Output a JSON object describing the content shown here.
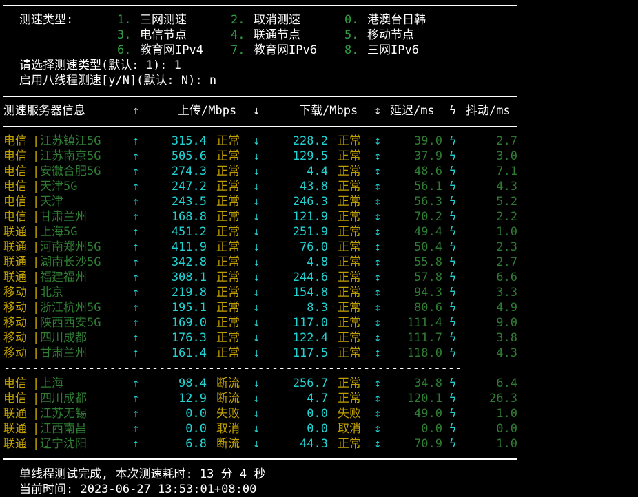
{
  "menu": {
    "label": "测速类型:",
    "options": [
      {
        "num": "1.",
        "text": "三网测速"
      },
      {
        "num": "2.",
        "text": "取消测速"
      },
      {
        "num": "0.",
        "text": "港澳台日韩"
      },
      {
        "num": "3.",
        "text": "电信节点"
      },
      {
        "num": "4.",
        "text": "联通节点"
      },
      {
        "num": "5.",
        "text": "移动节点"
      },
      {
        "num": "6.",
        "text": "教育网IPv4"
      },
      {
        "num": "7.",
        "text": "教育网IPv6"
      },
      {
        "num": "8.",
        "text": "三网IPv6"
      }
    ],
    "prompt_type": "请选择测速类型(默认: 1): 1",
    "prompt_threads": "启用八线程测速[y/N](默认: N): n"
  },
  "header": {
    "server": "测速服务器信息",
    "up_arrow": "↑",
    "upload": "上传/Mbps",
    "down_arrow": "↓",
    "download": "下载/Mbps",
    "updown_arrow": "↕",
    "latency": "延迟/ms",
    "jitter_symbol": "ϟ",
    "jitter": "抖动/ms"
  },
  "rows": [
    {
      "isp": "电信",
      "loc": "江苏镇江5G",
      "up": "315.4",
      "up_status": "正常",
      "down": "228.2",
      "down_status": "正常",
      "latency": "39.0",
      "jitter": "2.7"
    },
    {
      "isp": "电信",
      "loc": "江苏南京5G",
      "up": "505.6",
      "up_status": "正常",
      "down": "129.5",
      "down_status": "正常",
      "latency": "37.9",
      "jitter": "3.0"
    },
    {
      "isp": "电信",
      "loc": "安徽合肥5G",
      "up": "274.3",
      "up_status": "正常",
      "down": "4.4",
      "down_status": "正常",
      "latency": "48.6",
      "jitter": "7.1"
    },
    {
      "isp": "电信",
      "loc": "天津5G",
      "up": "247.2",
      "up_status": "正常",
      "down": "43.8",
      "down_status": "正常",
      "latency": "56.1",
      "jitter": "4.3"
    },
    {
      "isp": "电信",
      "loc": "天津",
      "up": "243.5",
      "up_status": "正常",
      "down": "246.3",
      "down_status": "正常",
      "latency": "56.3",
      "jitter": "5.2"
    },
    {
      "isp": "电信",
      "loc": "甘肃兰州",
      "up": "168.8",
      "up_status": "正常",
      "down": "121.9",
      "down_status": "正常",
      "latency": "70.2",
      "jitter": "2.2"
    },
    {
      "isp": "联通",
      "loc": "上海5G",
      "up": "451.2",
      "up_status": "正常",
      "down": "251.9",
      "down_status": "正常",
      "latency": "49.4",
      "jitter": "1.0"
    },
    {
      "isp": "联通",
      "loc": "河南郑州5G",
      "up": "411.9",
      "up_status": "正常",
      "down": "76.0",
      "down_status": "正常",
      "latency": "50.4",
      "jitter": "2.3"
    },
    {
      "isp": "联通",
      "loc": "湖南长沙5G",
      "up": "342.8",
      "up_status": "正常",
      "down": "4.8",
      "down_status": "正常",
      "latency": "55.8",
      "jitter": "2.7"
    },
    {
      "isp": "联通",
      "loc": "福建福州",
      "up": "308.1",
      "up_status": "正常",
      "down": "244.6",
      "down_status": "正常",
      "latency": "57.8",
      "jitter": "6.6"
    },
    {
      "isp": "移动",
      "loc": "北京",
      "up": "219.8",
      "up_status": "正常",
      "down": "154.8",
      "down_status": "正常",
      "latency": "94.3",
      "jitter": "3.3"
    },
    {
      "isp": "移动",
      "loc": "浙江杭州5G",
      "up": "195.1",
      "up_status": "正常",
      "down": "8.3",
      "down_status": "正常",
      "latency": "80.6",
      "jitter": "4.9"
    },
    {
      "isp": "移动",
      "loc": "陕西西安5G",
      "up": "169.0",
      "up_status": "正常",
      "down": "117.0",
      "down_status": "正常",
      "latency": "111.4",
      "jitter": "9.0"
    },
    {
      "isp": "移动",
      "loc": "四川成都",
      "up": "176.3",
      "up_status": "正常",
      "down": "122.4",
      "down_status": "正常",
      "latency": "111.7",
      "jitter": "3.8"
    },
    {
      "isp": "移动",
      "loc": "甘肃兰州",
      "up": "161.4",
      "up_status": "正常",
      "down": "117.5",
      "down_status": "正常",
      "latency": "118.0",
      "jitter": "4.3"
    }
  ],
  "separator": "-----------------------------------------------------------------",
  "rows2": [
    {
      "isp": "电信",
      "loc": "上海",
      "up": "98.4",
      "up_status": "断流",
      "down": "256.7",
      "down_status": "正常",
      "latency": "34.8",
      "jitter": "6.4"
    },
    {
      "isp": "电信",
      "loc": "四川成都",
      "up": "12.9",
      "up_status": "断流",
      "down": "4.7",
      "down_status": "正常",
      "latency": "120.1",
      "jitter": "26.3"
    },
    {
      "isp": "联通",
      "loc": "江苏无锡",
      "up": "0.0",
      "up_status": "失败",
      "down": "0.0",
      "down_status": "失败",
      "latency": "49.0",
      "jitter": "1.0"
    },
    {
      "isp": "联通",
      "loc": "江西南昌",
      "up": "0.0",
      "up_status": "取消",
      "down": "0.0",
      "down_status": "取消",
      "latency": "0.0",
      "jitter": "0.0"
    },
    {
      "isp": "联通",
      "loc": "辽宁沈阳",
      "up": "6.8",
      "up_status": "断流",
      "down": "44.3",
      "down_status": "正常",
      "latency": "70.9",
      "jitter": "1.0"
    }
  ],
  "footer": {
    "done": "单线程测试完成, 本次测速耗时: 13 分 4 秒",
    "time": "当前时间: 2023-06-27 13:53:01+08:00"
  }
}
